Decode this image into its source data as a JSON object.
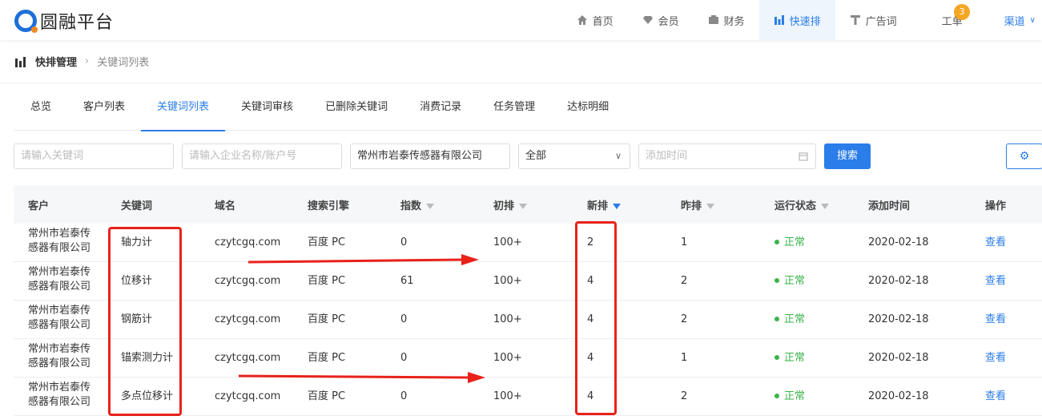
{
  "app": {
    "logo_text": "圆融平台"
  },
  "nav": {
    "items": [
      {
        "label": "首页",
        "icon": "home-icon"
      },
      {
        "label": "会员",
        "icon": "diamond-icon"
      },
      {
        "label": "财务",
        "icon": "wallet-icon"
      },
      {
        "label": "快速排",
        "icon": "bar-chart-icon",
        "active": true
      },
      {
        "label": "广告词",
        "icon": "text-icon"
      },
      {
        "label": "工单"
      },
      {
        "label": "渠道"
      }
    ],
    "ticket_badge": "3"
  },
  "breadcrumb": {
    "section": "快排管理",
    "page": "关键词列表"
  },
  "tabs": [
    "总览",
    "客户列表",
    "关键词列表",
    "关键词审核",
    "已删除关键词",
    "消费记录",
    "任务管理",
    "达标明细"
  ],
  "filters": {
    "keyword_placeholder": "请输入关键词",
    "company_placeholder": "请输入企业名称/账户号",
    "company_value": "常州市岩泰传感器有限公司",
    "status_value": "全部",
    "date_placeholder": "添加时间",
    "search_label": "搜索"
  },
  "table": {
    "headers": [
      "客户",
      "关键词",
      "域名",
      "搜索引擎",
      "指数",
      "初排",
      "新排",
      "昨排",
      "运行状态",
      "添加时间",
      "操作"
    ],
    "rows": [
      {
        "customer_line1": "常州市岩泰传",
        "customer_line2": "感器有限公司",
        "keyword": "轴力计",
        "domain": "czytcgq.com",
        "engine": "百度 PC",
        "index": "0",
        "initial": "100+",
        "new": "2",
        "yesterday": "1",
        "status": "正常",
        "date": "2020-02-18",
        "action": "查看"
      },
      {
        "customer_line1": "常州市岩泰传",
        "customer_line2": "感器有限公司",
        "keyword": "位移计",
        "domain": "czytcgq.com",
        "engine": "百度 PC",
        "index": "61",
        "initial": "100+",
        "new": "4",
        "yesterday": "2",
        "status": "正常",
        "date": "2020-02-18",
        "action": "查看"
      },
      {
        "customer_line1": "常州市岩泰传",
        "customer_line2": "感器有限公司",
        "keyword": "钢筋计",
        "domain": "czytcgq.com",
        "engine": "百度 PC",
        "index": "0",
        "initial": "100+",
        "new": "4",
        "yesterday": "2",
        "status": "正常",
        "date": "2020-02-18",
        "action": "查看"
      },
      {
        "customer_line1": "常州市岩泰传",
        "customer_line2": "感器有限公司",
        "keyword": "锚索测力计",
        "domain": "czytcgq.com",
        "engine": "百度 PC",
        "index": "0",
        "initial": "100+",
        "new": "4",
        "yesterday": "1",
        "status": "正常",
        "date": "2020-02-18",
        "action": "查看"
      },
      {
        "customer_line1": "常州市岩泰传",
        "customer_line2": "感器有限公司",
        "keyword": "多点位移计",
        "domain": "czytcgq.com",
        "engine": "百度 PC",
        "index": "0",
        "initial": "100+",
        "new": "4",
        "yesterday": "2",
        "status": "正常",
        "date": "2020-02-18",
        "action": "查看"
      }
    ]
  },
  "colors": {
    "accent": "#2b7de9",
    "annotation": "#e8221b",
    "status_ok": "#3bb34a",
    "badge": "#f5a623"
  }
}
